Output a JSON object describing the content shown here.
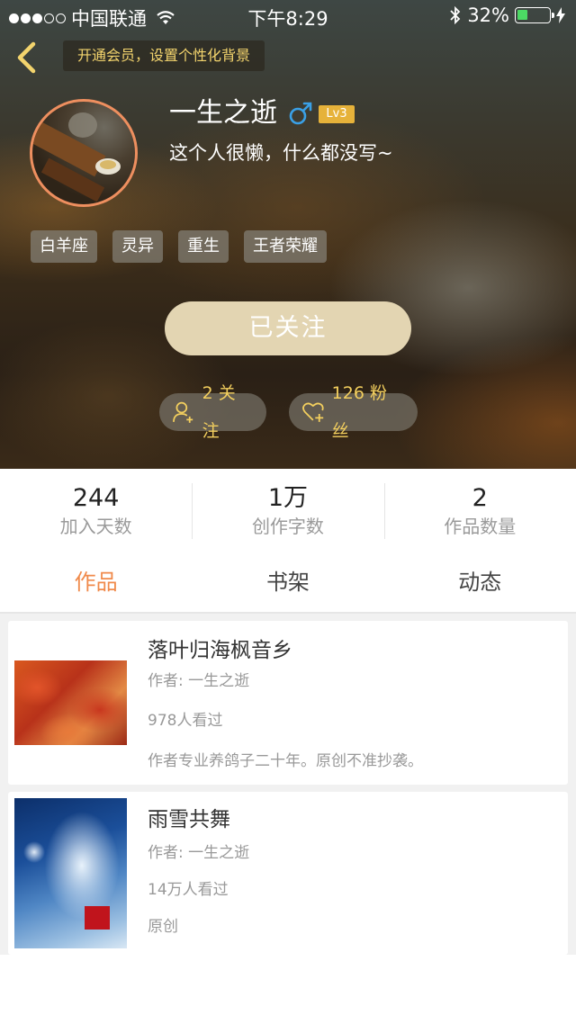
{
  "status_bar": {
    "carrier": "中国联通",
    "time": "下午8:29",
    "battery_percent": "32%",
    "battery_level": 0.32
  },
  "header": {
    "vip_banner": "开通会员，设置个性化背景"
  },
  "profile": {
    "name": "一生之逝",
    "gender": "male",
    "level": "Lv3",
    "bio": "这个人很懒，什么都没写~",
    "tags": [
      "白羊座",
      "灵异",
      "重生",
      "王者荣耀"
    ],
    "follow_button": "已关注",
    "following_label": "2 关注",
    "fans_label": "126 粉丝"
  },
  "stats": [
    {
      "value": "244",
      "label": "加入天数"
    },
    {
      "value": "1万",
      "label": "创作字数"
    },
    {
      "value": "2",
      "label": "作品数量"
    }
  ],
  "tabs": [
    {
      "label": "作品",
      "active": true
    },
    {
      "label": "书架",
      "active": false
    },
    {
      "label": "动态",
      "active": false
    }
  ],
  "works": [
    {
      "title": "落叶归海枫音乡",
      "author": "作者: 一生之逝",
      "views": "978人看过",
      "description": "作者专业养鸽子二十年。原创不准抄袭。"
    },
    {
      "title": "雨雪共舞",
      "author": "作者: 一生之逝",
      "views": "14万人看过",
      "description": "原创"
    }
  ],
  "colors": {
    "accent": "#f08a4b",
    "gold": "#f3cf5e",
    "follow_button": "#e3d5b2",
    "level_badge": "#e6b23a"
  }
}
